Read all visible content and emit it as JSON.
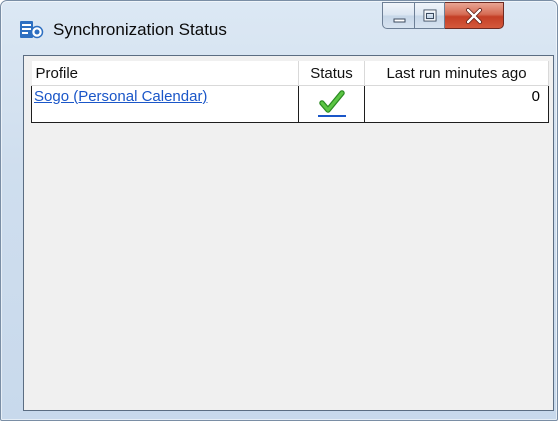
{
  "window": {
    "title": "Synchronization Status",
    "icon": "sync-app-icon",
    "caption_buttons": {
      "minimize_icon": "minimize-icon",
      "maximize_icon": "maximize-icon",
      "close_icon": "close-icon"
    }
  },
  "table": {
    "columns": [
      "Profile",
      "Status",
      "Last run minutes ago"
    ],
    "rows": [
      {
        "profile": "Sogo (Personal Calendar)",
        "status_icon": "checkmark-icon",
        "last_run": "0"
      }
    ]
  },
  "colors": {
    "link": "#1a56c8",
    "check": "#3aa72e",
    "close_button": "#c43f26"
  }
}
